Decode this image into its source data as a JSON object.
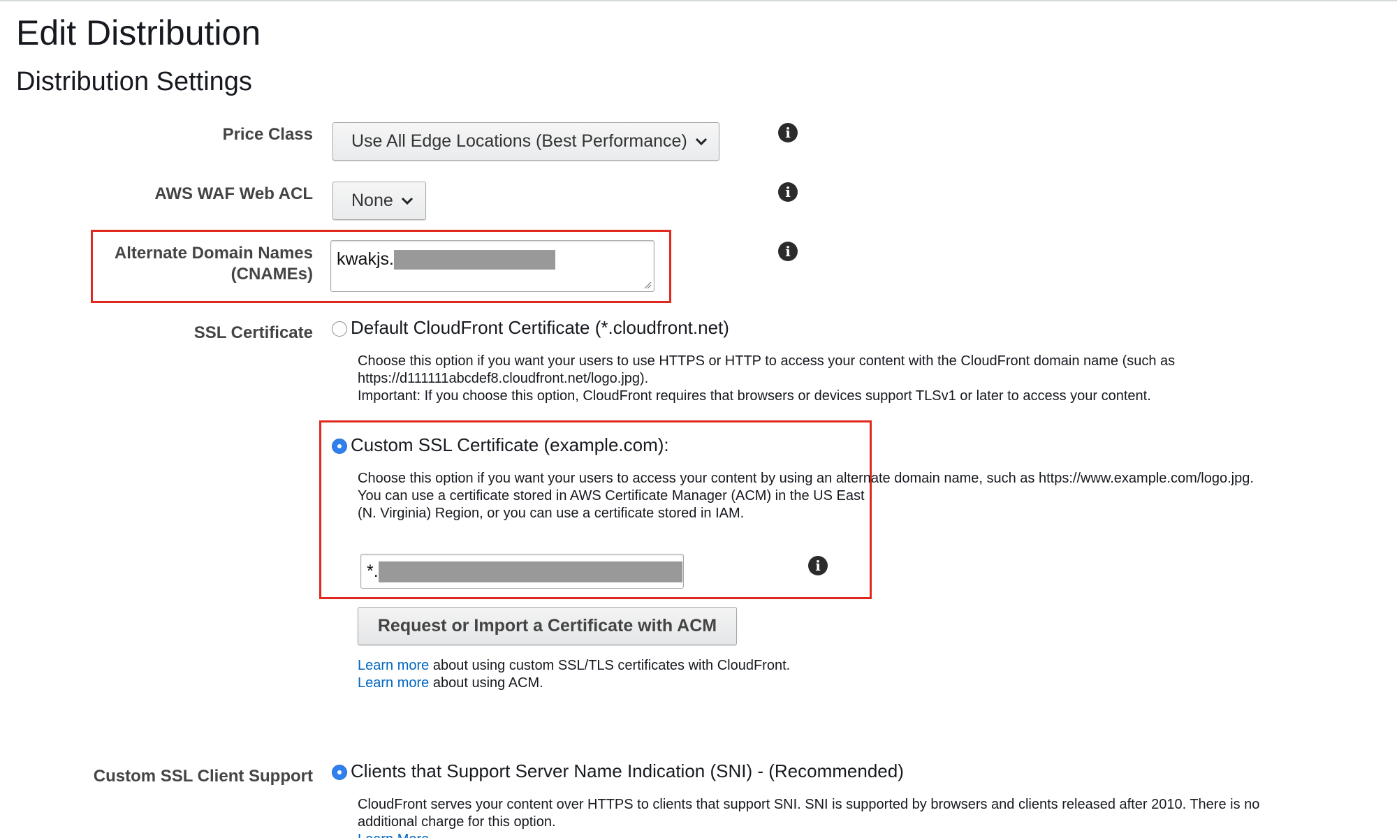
{
  "page": {
    "title": "Edit Distribution",
    "section_title": "Distribution Settings"
  },
  "price_class": {
    "label": "Price Class",
    "selected": "Use All Edge Locations (Best Performance)"
  },
  "waf": {
    "label": "AWS WAF Web ACL",
    "selected": "None"
  },
  "cnames": {
    "label_line1": "Alternate Domain Names",
    "label_line2": "(CNAMEs)",
    "value_visible": "kwakjs."
  },
  "ssl": {
    "label": "SSL Certificate",
    "default_option": {
      "label": "Default CloudFront Certificate (*.cloudfront.net)",
      "selected": false,
      "desc_line1": "Choose this option if you want your users to use HTTPS or HTTP to access your content with the CloudFront domain name (such as",
      "desc_line2": "https://d111111abcdef8.cloudfront.net/logo.jpg).",
      "desc_line3": "Important: If you choose this option, CloudFront requires that browsers or devices support TLSv1 or later to access your content."
    },
    "custom_option": {
      "label": "Custom SSL Certificate (example.com):",
      "selected": true,
      "desc_line1": "Choose this option if you want your users to access your content by using an alternate domain name, such as https://www.example.com/logo.jpg.",
      "desc_line2": "You can use a certificate stored in AWS Certificate Manager (ACM) in the US East",
      "desc_line3": "(N. Virginia) Region, or you can use a certificate stored in IAM.",
      "certificate_value_visible": "*."
    },
    "acm_button": "Request or Import a Certificate with ACM",
    "learn_more_1": "Learn more",
    "learn_more_1_rest": " about using custom SSL/TLS certificates with CloudFront.",
    "learn_more_2": "Learn more",
    "learn_more_2_rest": " about using ACM."
  },
  "client_support": {
    "label": "Custom SSL Client Support",
    "sni_option": {
      "label": "Clients that Support Server Name Indication (SNI) - (Recommended)",
      "selected": true,
      "desc_line1": "CloudFront serves your content over HTTPS to clients that support SNI. SNI is supported by browsers and clients released after 2010. There is no",
      "desc_line2": "additional charge for this option.",
      "learn_more_cut": "Learn More"
    }
  },
  "colors": {
    "highlight_red": "#e0291e",
    "radio_blue": "#2f80ed",
    "link_blue": "#0066c0"
  },
  "icons": [
    "info-icon",
    "chevron-down-icon"
  ]
}
